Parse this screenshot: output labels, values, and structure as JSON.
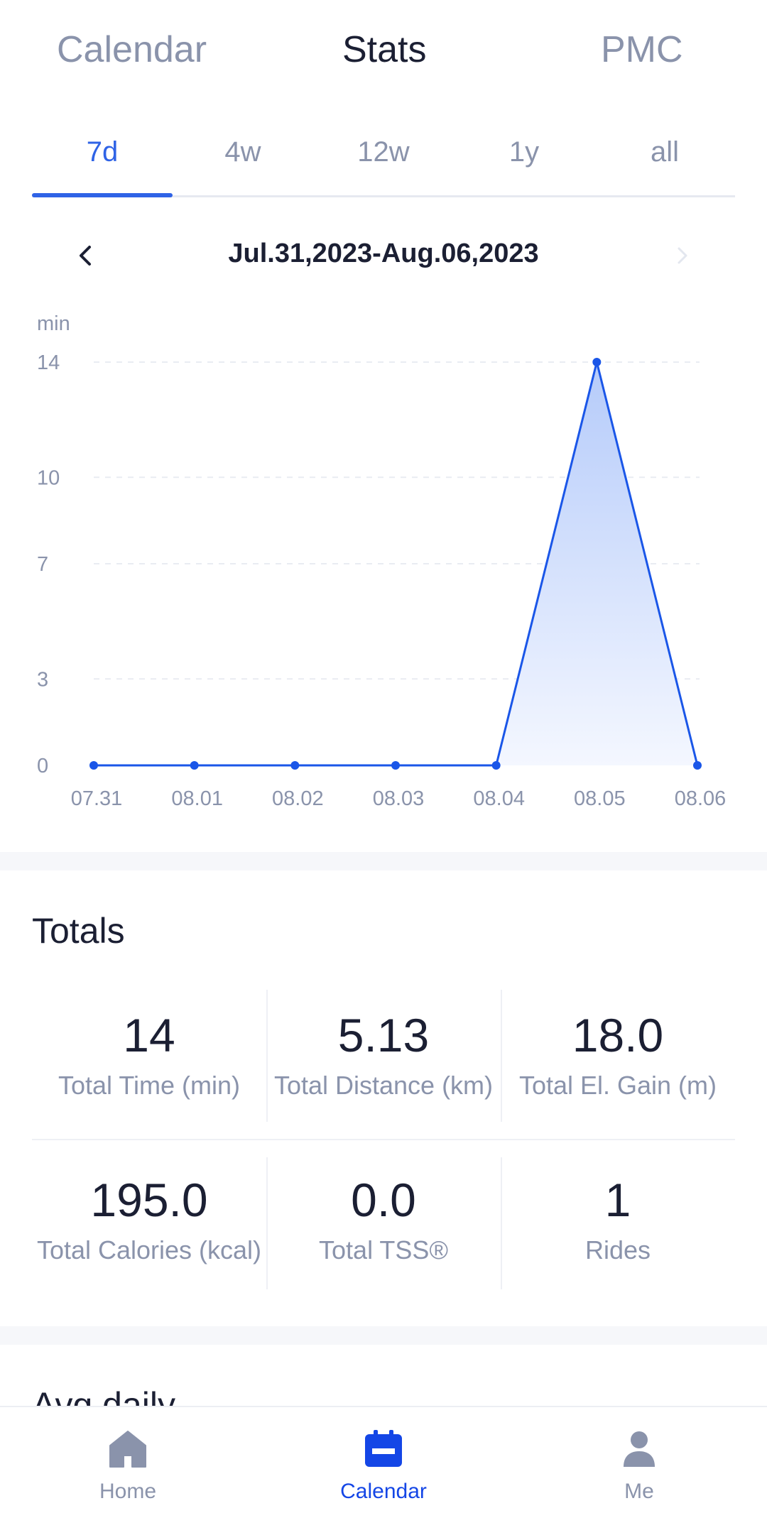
{
  "top_tabs": {
    "calendar": "Calendar",
    "stats": "Stats",
    "pmc": "PMC",
    "active": "Stats"
  },
  "range_tabs": {
    "items": [
      "7d",
      "4w",
      "12w",
      "1y",
      "all"
    ],
    "active": "7d"
  },
  "date_range": "Jul.31,2023-Aug.06,2023",
  "chart_data": {
    "type": "area",
    "unit_label": "min",
    "y_ticks": [
      "14",
      "10",
      "7",
      "3",
      "0"
    ],
    "ylim": [
      0,
      14
    ],
    "x": [
      "07.31",
      "08.01",
      "08.02",
      "08.03",
      "08.04",
      "08.05",
      "08.06"
    ],
    "values": [
      0,
      0,
      0,
      0,
      0,
      14,
      0
    ],
    "grid": true,
    "color": "#1a56e8"
  },
  "totals": {
    "title": "Totals",
    "items": [
      {
        "value": "14",
        "label": "Total Time (min)"
      },
      {
        "value": "5.13",
        "label": "Total Distance (km)"
      },
      {
        "value": "18.0",
        "label": "Total El. Gain (m)"
      },
      {
        "value": "195.0",
        "label": "Total Calories (kcal)"
      },
      {
        "value": "0.0",
        "label": "Total TSS®"
      },
      {
        "value": "1",
        "label": "Rides"
      }
    ]
  },
  "avg_daily": {
    "title": "Avg daily"
  },
  "bottom_nav": {
    "items": [
      {
        "label": "Home",
        "icon": "home-icon"
      },
      {
        "label": "Calendar",
        "icon": "calendar-icon"
      },
      {
        "label": "Me",
        "icon": "person-icon"
      }
    ],
    "active": "Calendar",
    "active_color": "#1446e6",
    "inactive_color": "#8a93ab"
  }
}
